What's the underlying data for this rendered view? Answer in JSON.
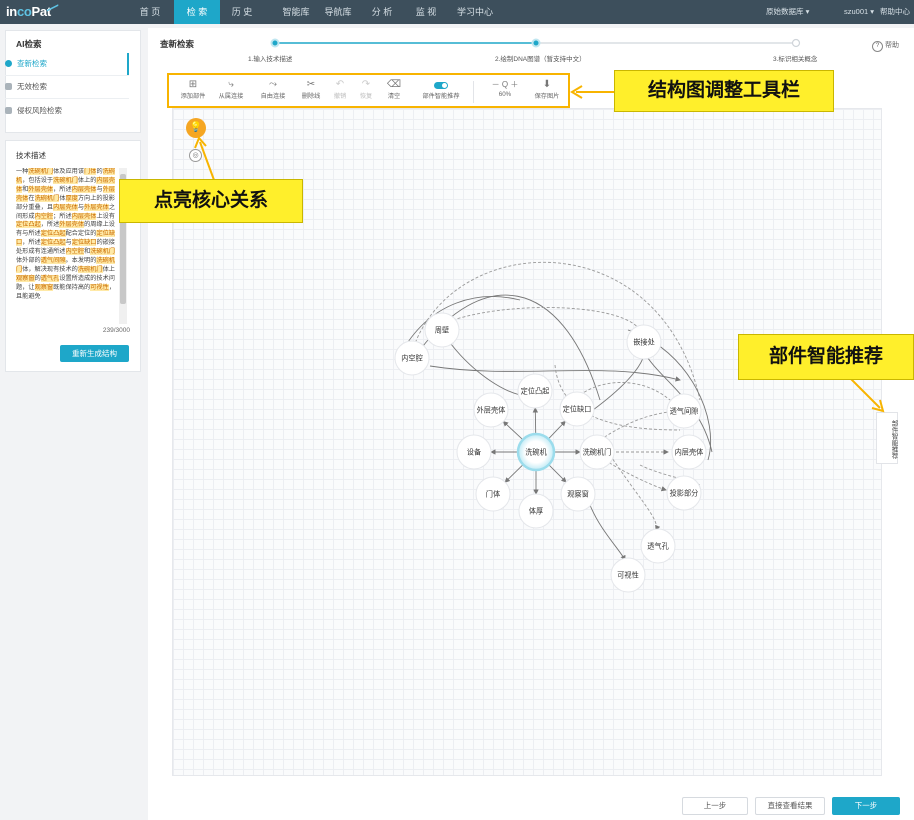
{
  "nav": {
    "logo": {
      "part1": "in",
      "part2": "co",
      "part3": "Pat"
    },
    "items": [
      "首 页",
      "检 索",
      "历 史",
      "智能库",
      "导航库",
      "分 析",
      "监 视",
      "学习中心"
    ],
    "active_index": 1,
    "database": "原始数据库",
    "user": "szu001",
    "help_center": "帮助中心"
  },
  "sidebar": {
    "title": "AI检索",
    "items": [
      {
        "label": "查新检索",
        "active": true
      },
      {
        "label": "无效检索",
        "active": false
      },
      {
        "label": "侵权风险检索",
        "active": false
      }
    ],
    "desc_title": "技术描述",
    "desc_segments": [
      {
        "t": "一种",
        "h": false
      },
      {
        "t": "洗碗机门",
        "h": true
      },
      {
        "t": "体及应用该",
        "h": false
      },
      {
        "t": "门体",
        "h": true
      },
      {
        "t": "的",
        "h": false
      },
      {
        "t": "洗碗机",
        "h": true
      },
      {
        "t": "，包括设于",
        "h": false
      },
      {
        "t": "洗碗机门",
        "h": true
      },
      {
        "t": "体上的",
        "h": false
      },
      {
        "t": "内层壳体",
        "h": true
      },
      {
        "t": "和",
        "h": false
      },
      {
        "t": "外层壳体",
        "h": true
      },
      {
        "t": "，所述",
        "h": false
      },
      {
        "t": "内层壳体",
        "h": true
      },
      {
        "t": "与",
        "h": false
      },
      {
        "t": "外层壳体",
        "h": true
      },
      {
        "t": "在",
        "h": false
      },
      {
        "t": "洗碗机门",
        "h": true
      },
      {
        "t": "体",
        "h": false
      },
      {
        "t": "厚度",
        "h": true
      },
      {
        "t": "方向上的投影部分重叠，且",
        "h": false
      },
      {
        "t": "内层壳体",
        "h": true
      },
      {
        "t": "与",
        "h": false
      },
      {
        "t": "外层壳体",
        "h": true
      },
      {
        "t": "之间形成",
        "h": false
      },
      {
        "t": "内空腔",
        "h": true
      },
      {
        "t": "；所述",
        "h": false
      },
      {
        "t": "内层壳体",
        "h": true
      },
      {
        "t": "上设有",
        "h": false
      },
      {
        "t": "定位凸起",
        "h": true
      },
      {
        "t": "，所述",
        "h": false
      },
      {
        "t": "外层壳体",
        "h": true
      },
      {
        "t": "的周缘上设有与所述",
        "h": false
      },
      {
        "t": "定位凸起",
        "h": true
      },
      {
        "t": "配合定位的",
        "h": false
      },
      {
        "t": "定位缺口",
        "h": true
      },
      {
        "t": "，所述",
        "h": false
      },
      {
        "t": "定位凸起",
        "h": true
      },
      {
        "t": "与",
        "h": false
      },
      {
        "t": "定位缺口",
        "h": true
      },
      {
        "t": "的嵌接处形成有连通所述",
        "h": false
      },
      {
        "t": "内空腔",
        "h": true
      },
      {
        "t": "和",
        "h": false
      },
      {
        "t": "洗碗机门",
        "h": true
      },
      {
        "t": "体外部的",
        "h": false
      },
      {
        "t": "透气间隙",
        "h": true
      },
      {
        "t": "。本发明的",
        "h": false
      },
      {
        "t": "洗碗机门",
        "h": true
      },
      {
        "t": "体，解决现有技术的",
        "h": false
      },
      {
        "t": "洗碗机门",
        "h": true
      },
      {
        "t": "体上",
        "h": false
      },
      {
        "t": "观察窗",
        "h": true
      },
      {
        "t": "的",
        "h": false
      },
      {
        "t": "透气孔",
        "h": true
      },
      {
        "t": "设置所造成的技术问题，让",
        "h": false
      },
      {
        "t": "观察窗",
        "h": true
      },
      {
        "t": "既能保持高的",
        "h": false
      },
      {
        "t": "可视性",
        "h": true
      },
      {
        "t": "，且能避免",
        "h": false
      }
    ],
    "char_count": "239/3000",
    "regen_button": "重新生成结构"
  },
  "main": {
    "title": "查新检索",
    "help": "帮助",
    "steps": [
      "1.输入技术描述",
      "2.绘制DNA图谱（暂支持中文）",
      "3.标识相关概念"
    ],
    "current_step": 2
  },
  "toolbar": {
    "tools": [
      {
        "label": "添加部件",
        "glyph": "⊞",
        "enabled": true
      },
      {
        "label": "从属连接",
        "glyph": "⤷",
        "enabled": true
      },
      {
        "label": "自由连接",
        "glyph": "⤳",
        "enabled": true
      },
      {
        "label": "删除线",
        "glyph": "✂",
        "enabled": true
      },
      {
        "label": "撤销",
        "glyph": "↶",
        "enabled": false
      },
      {
        "label": "恢复",
        "glyph": "↷",
        "enabled": false
      },
      {
        "label": "清空",
        "glyph": "⌫",
        "enabled": true
      }
    ],
    "recommend_label": "部件智能推荐",
    "zoom_text": "60%",
    "zoom_controls": "－ Q ＋",
    "save_label": "保存图片"
  },
  "callouts": {
    "toolbar": "结构图调整工具栏",
    "core": "点亮核心关系",
    "recommend": "部件智能推荐"
  },
  "side_tab": "部件智能推荐",
  "graph": {
    "center": "洗碗机",
    "nodes": [
      "内空腔",
      "周壁",
      "外层壳体",
      "定位凸起",
      "定位缺口",
      "嵌接处",
      "透气间隙",
      "洗碗机门",
      "内层壳体",
      "设备",
      "门体",
      "体厚",
      "观察窗",
      "投影部分",
      "透气孔",
      "可视性"
    ]
  },
  "footer": {
    "prev": "上一步",
    "direct": "直接查看结果",
    "next": "下一步"
  },
  "colors": {
    "accent": "#1ea7c9",
    "highlight": "#f8b400",
    "callout": "#ffef2b",
    "topbar": "#3d4f5c"
  }
}
